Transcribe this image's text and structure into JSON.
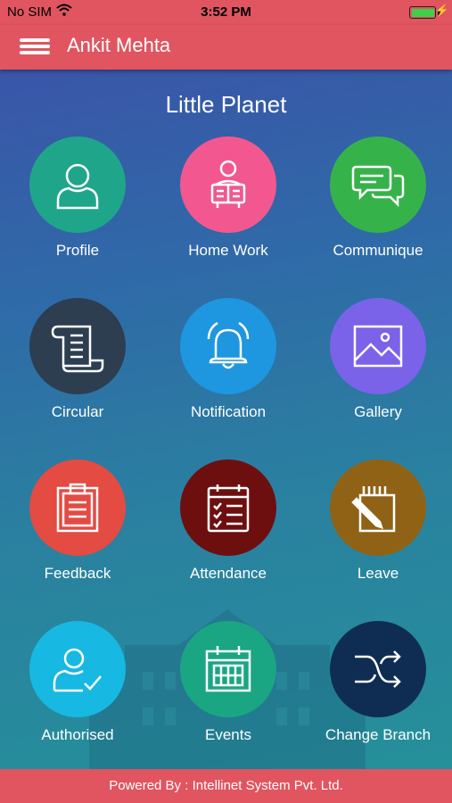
{
  "status_bar": {
    "carrier": "No SIM",
    "time": "3:52 PM"
  },
  "header": {
    "user_name": "Ankit Mehta"
  },
  "school": {
    "name": "Little Planet"
  },
  "tiles": [
    {
      "label": "Profile",
      "color": "#1fa68a",
      "icon": "profile-icon"
    },
    {
      "label": "Home Work",
      "color": "#f2588f",
      "icon": "homework-icon"
    },
    {
      "label": "Communique",
      "color": "#35b34a",
      "icon": "chat-icon"
    },
    {
      "label": "Circular",
      "color": "#2c3e50",
      "icon": "scroll-icon"
    },
    {
      "label": "Notification",
      "color": "#1e96e0",
      "icon": "bell-icon"
    },
    {
      "label": "Gallery",
      "color": "#7a63e8",
      "icon": "image-icon"
    },
    {
      "label": "Feedback",
      "color": "#e34b43",
      "icon": "clipboard-icon"
    },
    {
      "label": "Attendance",
      "color": "#6e0f0f",
      "icon": "calendar-check-icon"
    },
    {
      "label": "Leave",
      "color": "#8f6216",
      "icon": "write-icon"
    },
    {
      "label": "Authorised",
      "color": "#17b8e2",
      "icon": "user-check-icon"
    },
    {
      "label": "Events",
      "color": "#1aa682",
      "icon": "calendar-icon"
    },
    {
      "label": "Change Branch",
      "color": "#0f2d52",
      "icon": "shuffle-icon"
    }
  ],
  "footer": {
    "text": "Powered By : Intellinet System Pvt. Ltd."
  }
}
